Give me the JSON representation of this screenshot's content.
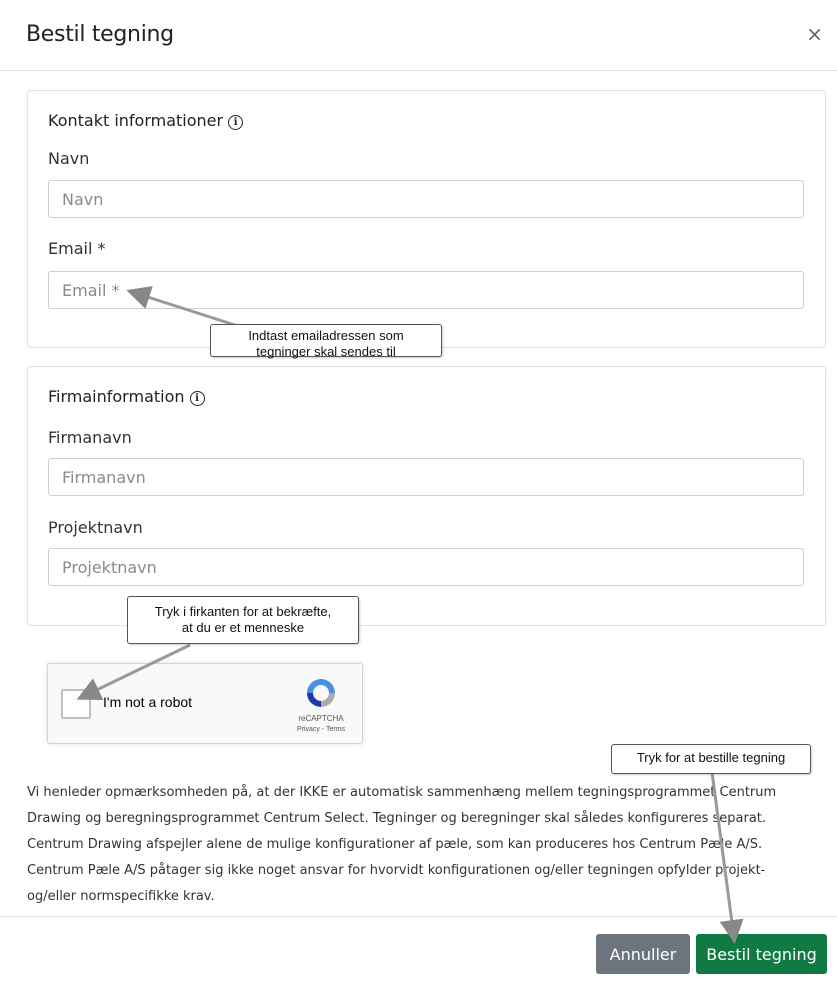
{
  "dialog": {
    "title": "Bestil tegning",
    "close_label": "×"
  },
  "contact": {
    "heading": "Kontakt informationer",
    "info_icon": "info-icon",
    "name_label": "Navn",
    "name_placeholder": "Navn",
    "email_label": "Email *",
    "email_placeholder": "Email *"
  },
  "company": {
    "heading": "Firmainformation",
    "info_icon": "info-icon",
    "company_label": "Firmanavn",
    "company_placeholder": "Firmanavn",
    "project_label": "Projektnavn",
    "project_placeholder": "Projektnavn"
  },
  "recaptcha": {
    "label": "I'm not a robot",
    "brand": "reCAPTCHA",
    "terms": "Privacy - Terms",
    "checked": false
  },
  "callouts": {
    "email_hint_line1": "Indtast emailadressen som",
    "email_hint_line2": "tegninger skal sendes til",
    "captcha_hint_line1": "Tryk i firkanten for at bekræfte,",
    "captcha_hint_line2": "at du er et menneske",
    "submit_hint": "Tryk for at bestille tegning"
  },
  "disclaimer": "Vi henleder opmærksomheden på, at der IKKE er automatisk sammenhæng mellem tegningsprogrammet Centrum Drawing og beregningsprogrammet Centrum Select. Tegninger og beregninger skal således konfigureres separat. Centrum Drawing afspejler alene de mulige konfigurationer af pæle, som kan produceres hos Centrum Pæle A/S. Centrum Pæle A/S påtager sig ikke noget ansvar for hvorvidt konfigurationen og/eller tegningen opfylder projekt- og/eller normspecifikke krav.",
  "buttons": {
    "cancel": "Annuller",
    "submit": "Bestil tegning"
  },
  "colors": {
    "submit": "#0f7a41",
    "cancel": "#6c757d"
  }
}
